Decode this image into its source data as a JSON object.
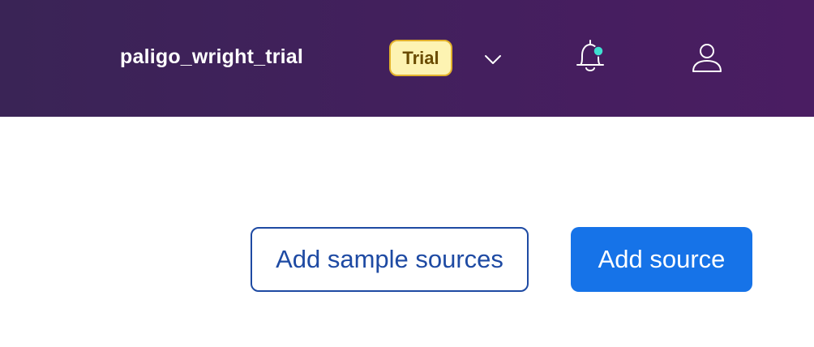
{
  "header": {
    "workspace_name": "paligo_wright_trial",
    "badge_label": "Trial",
    "icons": {
      "dropdown": "chevron-down-icon",
      "notifications": "bell-icon",
      "notification_dot_color": "#3ee0d0",
      "account": "user-icon"
    }
  },
  "actions": {
    "add_sample_sources_label": "Add sample sources",
    "add_source_label": "Add source"
  },
  "colors": {
    "header_bg": "#441f5e",
    "primary": "#1673e8",
    "outline": "#1e4aa3",
    "badge_bg": "#fdf3b2",
    "badge_border": "#e3b22c"
  }
}
